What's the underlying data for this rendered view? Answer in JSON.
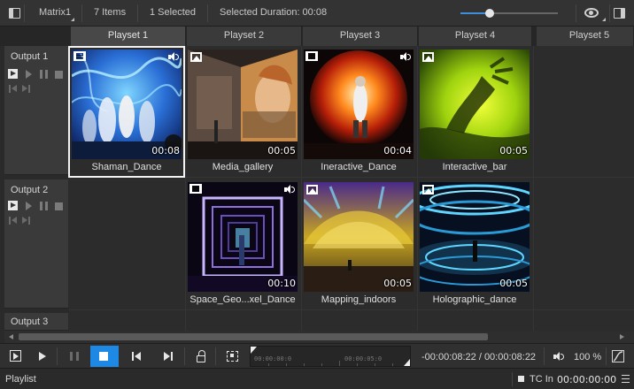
{
  "toolbar": {
    "matrix_name": "Matrix1",
    "item_count": "7 Items",
    "selected_count": "1 Selected",
    "selected_duration": "Selected Duration: 00:08",
    "zoom_level": 0.3
  },
  "playsets": [
    "Playset 1",
    "Playset 2",
    "Playset 3",
    "Playset 4",
    "Playset 5"
  ],
  "outputs": [
    {
      "label": "Output 1"
    },
    {
      "label": "Output 2"
    },
    {
      "label": "Output 3"
    }
  ],
  "media": [
    {
      "name": "Shaman_Dance",
      "duration": "00:08",
      "kind": "video-icon",
      "audio": true,
      "selected": true
    },
    {
      "name": "Media_gallery",
      "duration": "00:05",
      "kind": "image-icon",
      "audio": false,
      "selected": false
    },
    {
      "name": "Ineractive_Dance",
      "duration": "00:04",
      "kind": "video-icon",
      "audio": true,
      "selected": false
    },
    {
      "name": "Interactive_bar",
      "duration": "00:05",
      "kind": "image-icon",
      "audio": false,
      "selected": false
    },
    {
      "name": "Space_Geo...xel_Dance",
      "duration": "00:10",
      "kind": "video-icon",
      "audio": true,
      "selected": false
    },
    {
      "name": "Mapping_indoors",
      "duration": "00:05",
      "kind": "image-icon",
      "audio": false,
      "selected": false
    },
    {
      "name": "Holographic_dance",
      "duration": "00:05",
      "kind": "image-icon",
      "audio": false,
      "selected": false
    }
  ],
  "transport": {
    "timeline_start": "00:00:00:0",
    "timeline_mid": "00:00:05:0",
    "timecode": "-00:00:08:22 / 00:00:08:22",
    "volume": "100 %"
  },
  "status": {
    "label": "Playlist",
    "tc_label": "TC In",
    "tc_value": "00:00:00:00"
  },
  "colors": {
    "accent": "#1e88e5",
    "background": "#2a2a2a"
  }
}
